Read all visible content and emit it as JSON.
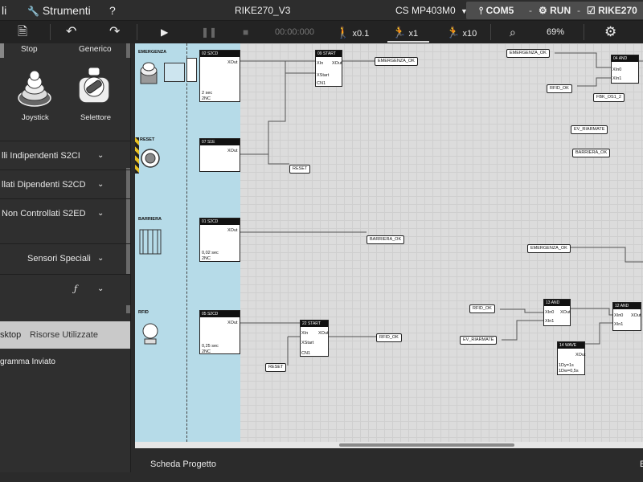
{
  "menubar": {
    "file_fragment": "li",
    "tools": "Strumenti",
    "help": "?",
    "project": "RIKE270_V3",
    "cs": "CS MP403M0",
    "com": "COM5",
    "run": "RUN",
    "device": "RIKE270"
  },
  "toolbar": {
    "time": "00:00:000",
    "speed_01": "x0.1",
    "speed_1": "x1",
    "speed_10": "x10",
    "zoom": "69%"
  },
  "sidebar": {
    "stop": "Stop",
    "generic": "Generico",
    "joystick": "Joystick",
    "selector": "Selettore",
    "sections": [
      "lli Indipendenti S2CI",
      "llati Dipendenti S2CD",
      "Non Controllati S2ED",
      "Sensori Speciali"
    ],
    "tab_desktop": "sktop",
    "tab_resources": "Risorse Utilizzate",
    "sent": "gramma Inviato"
  },
  "canvas": {
    "inputs": [
      {
        "label": "EMERGENZA",
        "num": "02",
        "type": "S2CD",
        "time": "2 sec",
        "ch": "2NC"
      },
      {
        "label": "RESET",
        "num": "07",
        "type": "S1E"
      },
      {
        "label": "BARRIERA",
        "num": "01",
        "type": "S2CD",
        "time": "0,02 sec",
        "ch": "2NC"
      },
      {
        "label": "RFID",
        "num": "05",
        "type": "S2CD",
        "time": "0,25 sec",
        "ch": "2NC"
      }
    ],
    "xout": "XOut",
    "start_a": {
      "num": "09",
      "title": "START",
      "in1": "XIn",
      "in2": "XStart",
      "foot": "CN1"
    },
    "start_b": {
      "num": "22",
      "title": "START",
      "in1": "XIn",
      "in2": "XStart",
      "foot": "CN1"
    },
    "and_a": {
      "num": "04",
      "title": "AND",
      "in1": "XIn0",
      "in2": "XIn1"
    },
    "and_b": {
      "num": "12",
      "title": "AND",
      "in1": "XIn0",
      "in2": "XIn1"
    },
    "and_c": {
      "num": "13",
      "title": "AND",
      "in1": "XIn0",
      "in2": "XIn1"
    },
    "wave": {
      "num": "14",
      "title": "WAVE",
      "l1": "1Dy=1s",
      "l2": "1Dw=0,5s"
    },
    "tags": {
      "emergenza_ok": "EMERGENZA_OK",
      "reset": "RESET",
      "barriera_ok": "BARRIERA_OK",
      "rfid_ok": "RFID_OK",
      "fbk_os1": "FBK_OS1_2",
      "ev_riarmate": "EV_RIARMATE",
      "barriera_ok2": "BARRIERA_OK"
    }
  },
  "bottom": {
    "tab": "Scheda Progetto",
    "right": "E"
  }
}
